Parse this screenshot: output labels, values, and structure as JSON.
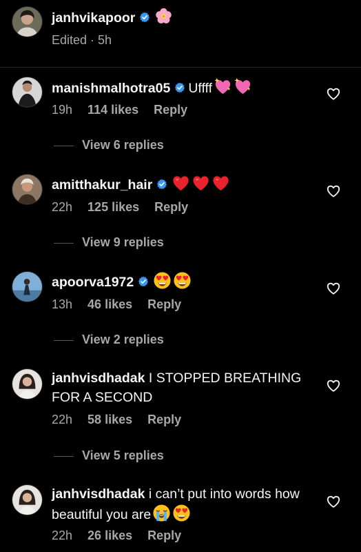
{
  "caption": {
    "username": "janhvikapoor",
    "meta": "Edited · 5h",
    "avatar_icon": "avatar-photo-icon",
    "emoji_icon": "pink-flower-icon"
  },
  "comments": [
    {
      "username": "manishmalhotra05",
      "text": "Uffff",
      "time": "19h",
      "likes": "114 likes",
      "reply": "Reply",
      "view_replies": "View 6 replies",
      "emojis": [
        "sparkling-heart-icon",
        "sparkling-heart-icon"
      ]
    },
    {
      "username": "amitthakur_hair",
      "text": "",
      "time": "22h",
      "likes": "125 likes",
      "reply": "Reply",
      "view_replies": "View 9 replies",
      "emojis": [
        "red-heart-icon",
        "red-heart-icon",
        "red-heart-icon"
      ]
    },
    {
      "username": "apoorva1972",
      "text": "",
      "time": "13h",
      "likes": "46 likes",
      "reply": "Reply",
      "view_replies": "View 2 replies",
      "emojis": [
        "heart-eyes-icon",
        "heart-eyes-icon"
      ]
    },
    {
      "username": "janhvisdhadak",
      "text": "I STOPPED BREATHING FOR A SECOND",
      "time": "22h",
      "likes": "58 likes",
      "reply": "Reply",
      "view_replies": "View 5 replies",
      "emojis": []
    },
    {
      "username": "janhvisdhadak",
      "text": "i can’t put into words how beautiful you are",
      "time": "22h",
      "likes": "26 likes",
      "reply": "Reply",
      "emojis": [
        "loudly-crying-icon",
        "heart-eyes-icon"
      ]
    }
  ],
  "colors": {
    "background": "#000000",
    "text": "#f5f5f5",
    "secondary_text": "#a8a8a8",
    "verified_badge": "#3897f0"
  }
}
